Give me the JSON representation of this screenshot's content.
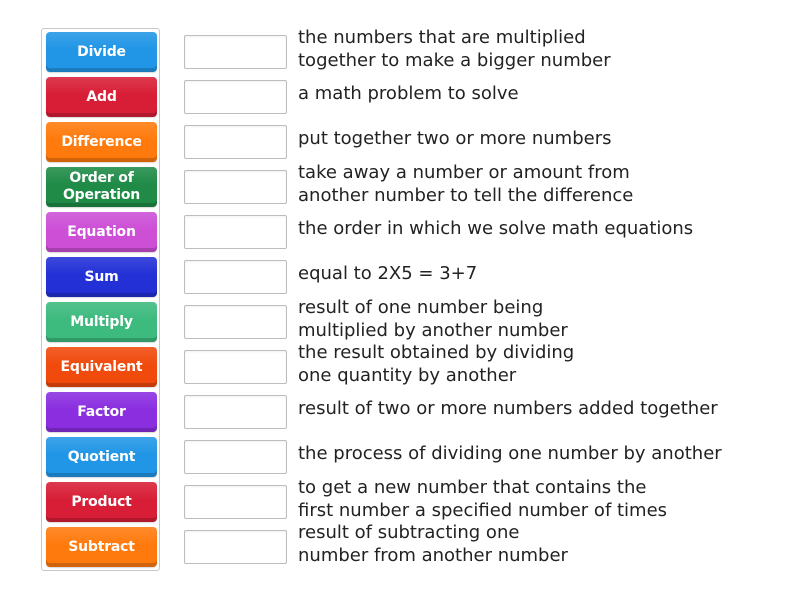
{
  "terms": [
    {
      "label": "Divide",
      "color": "#2196e6"
    },
    {
      "label": "Add",
      "color": "#d81e36"
    },
    {
      "label": "Difference",
      "color": "#ff7a0d"
    },
    {
      "label": "Order of Operation",
      "color": "#1f8b47"
    },
    {
      "label": "Equation",
      "color": "#cc4fd6"
    },
    {
      "label": "Sum",
      "color": "#2230d6"
    },
    {
      "label": "Multiply",
      "color": "#3dba7e"
    },
    {
      "label": "Equivalent",
      "color": "#f04a0c"
    },
    {
      "label": "Factor",
      "color": "#8a2ee0"
    },
    {
      "label": "Quotient",
      "color": "#2196e6"
    },
    {
      "label": "Product",
      "color": "#d81e36"
    },
    {
      "label": "Subtract",
      "color": "#ff7a0d"
    }
  ],
  "definitions": [
    {
      "text": "the numbers that are multiplied\ntogether to make a bigger number"
    },
    {
      "text": "a math problem to solve"
    },
    {
      "text": "put together two or more numbers"
    },
    {
      "text": "take away a number or amount from\nanother number to tell the difference"
    },
    {
      "text": "the order in which we solve math equations"
    },
    {
      "text": "equal to 2X5 = 3+7"
    },
    {
      "text": "result of one number being\nmultiplied by another number"
    },
    {
      "text": "the result obtained by dividing\none quantity by another"
    },
    {
      "text": "result of two or more numbers added together"
    },
    {
      "text": "the process of dividing one number by another"
    },
    {
      "text": "to get a new number that contains the\nfirst number a specified number of times"
    },
    {
      "text": "result of subtracting one\nnumber from another number"
    }
  ],
  "drop_boxes": [
    {
      "value": ""
    },
    {
      "value": ""
    },
    {
      "value": ""
    },
    {
      "value": ""
    },
    {
      "value": ""
    },
    {
      "value": ""
    },
    {
      "value": ""
    },
    {
      "value": ""
    },
    {
      "value": ""
    },
    {
      "value": ""
    },
    {
      "value": ""
    },
    {
      "value": ""
    }
  ]
}
